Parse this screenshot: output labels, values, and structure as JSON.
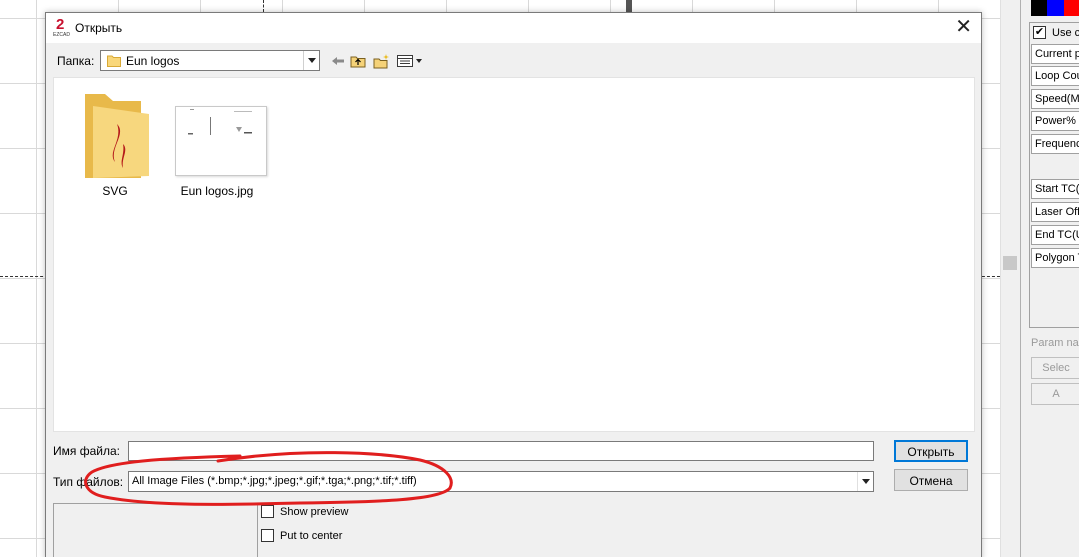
{
  "dialog": {
    "title": "Открыть",
    "app_logo_number": "2",
    "app_logo_text": "EZCAD",
    "lookin_label": "Папка:",
    "lookin_value": "Eun logos",
    "files": [
      {
        "name": "SVG",
        "kind": "folder"
      },
      {
        "name": "Eun logos.jpg",
        "kind": "image"
      }
    ],
    "filename_label": "Имя файла:",
    "filename_value": "",
    "filetype_label": "Тип файлов:",
    "filetype_value": "All Image Files (*.bmp;*.jpg;*.jpeg;*.gif;*.tga;*.png;*.tif;*.tiff)",
    "open_button": "Открыть",
    "cancel_button": "Отмена",
    "show_preview_label": "Show preview",
    "show_preview_checked": false,
    "put_to_center_label": "Put to center",
    "put_to_center_checked": false
  },
  "right_panel": {
    "swatch_colors": [
      "#000000",
      "#0000ff",
      "#ff0000"
    ],
    "use_label": "Use c",
    "use_checked": true,
    "fields": [
      "Current pe",
      "Loop Cou",
      "Speed(MI",
      "Power%",
      "Frequenc",
      "Start TC(U",
      "Laser Off",
      "End TC(U",
      "Polygon T"
    ],
    "param_label": "Param nar",
    "select_button": "Selec",
    "a_button": "A"
  },
  "annotation_color": "#e01e1e"
}
